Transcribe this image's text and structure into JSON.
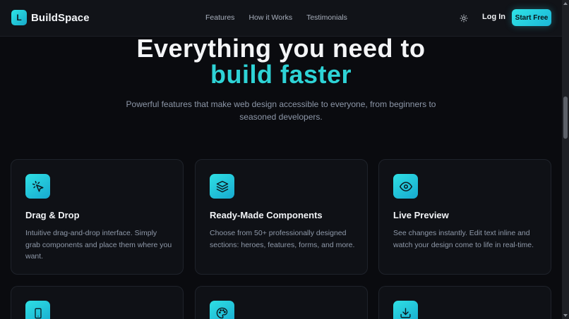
{
  "brand": {
    "logo_letter": "L",
    "name": "BuildSpace"
  },
  "nav": {
    "links": [
      "Features",
      "How it Works",
      "Testimonials"
    ],
    "login_label": "Log In",
    "cta_label": "Start Free",
    "theme_icon": "sun-icon"
  },
  "hero": {
    "line1": "Everything you need to",
    "line2": "build faster",
    "subtitle": "Powerful features that make web design accessible to everyone, from beginners to seasoned developers."
  },
  "features": [
    {
      "icon": "cursor-click-icon",
      "title": "Drag & Drop",
      "description": "Intuitive drag-and-drop interface. Simply grab components and place them where you want."
    },
    {
      "icon": "layers-icon",
      "title": "Ready-Made Components",
      "description": "Choose from 50+ professionally designed sections: heroes, features, forms, and more."
    },
    {
      "icon": "eye-icon",
      "title": "Live Preview",
      "description": "See changes instantly. Edit text inline and watch your design come to life in real-time."
    },
    {
      "icon": "smartphone-icon",
      "title": "",
      "description": ""
    },
    {
      "icon": "palette-icon",
      "title": "",
      "description": ""
    },
    {
      "icon": "download-icon",
      "title": "",
      "description": ""
    }
  ],
  "colors": {
    "accent": "#2ed3d6",
    "background": "#0a0b0f",
    "card_border": "#1f232b"
  }
}
